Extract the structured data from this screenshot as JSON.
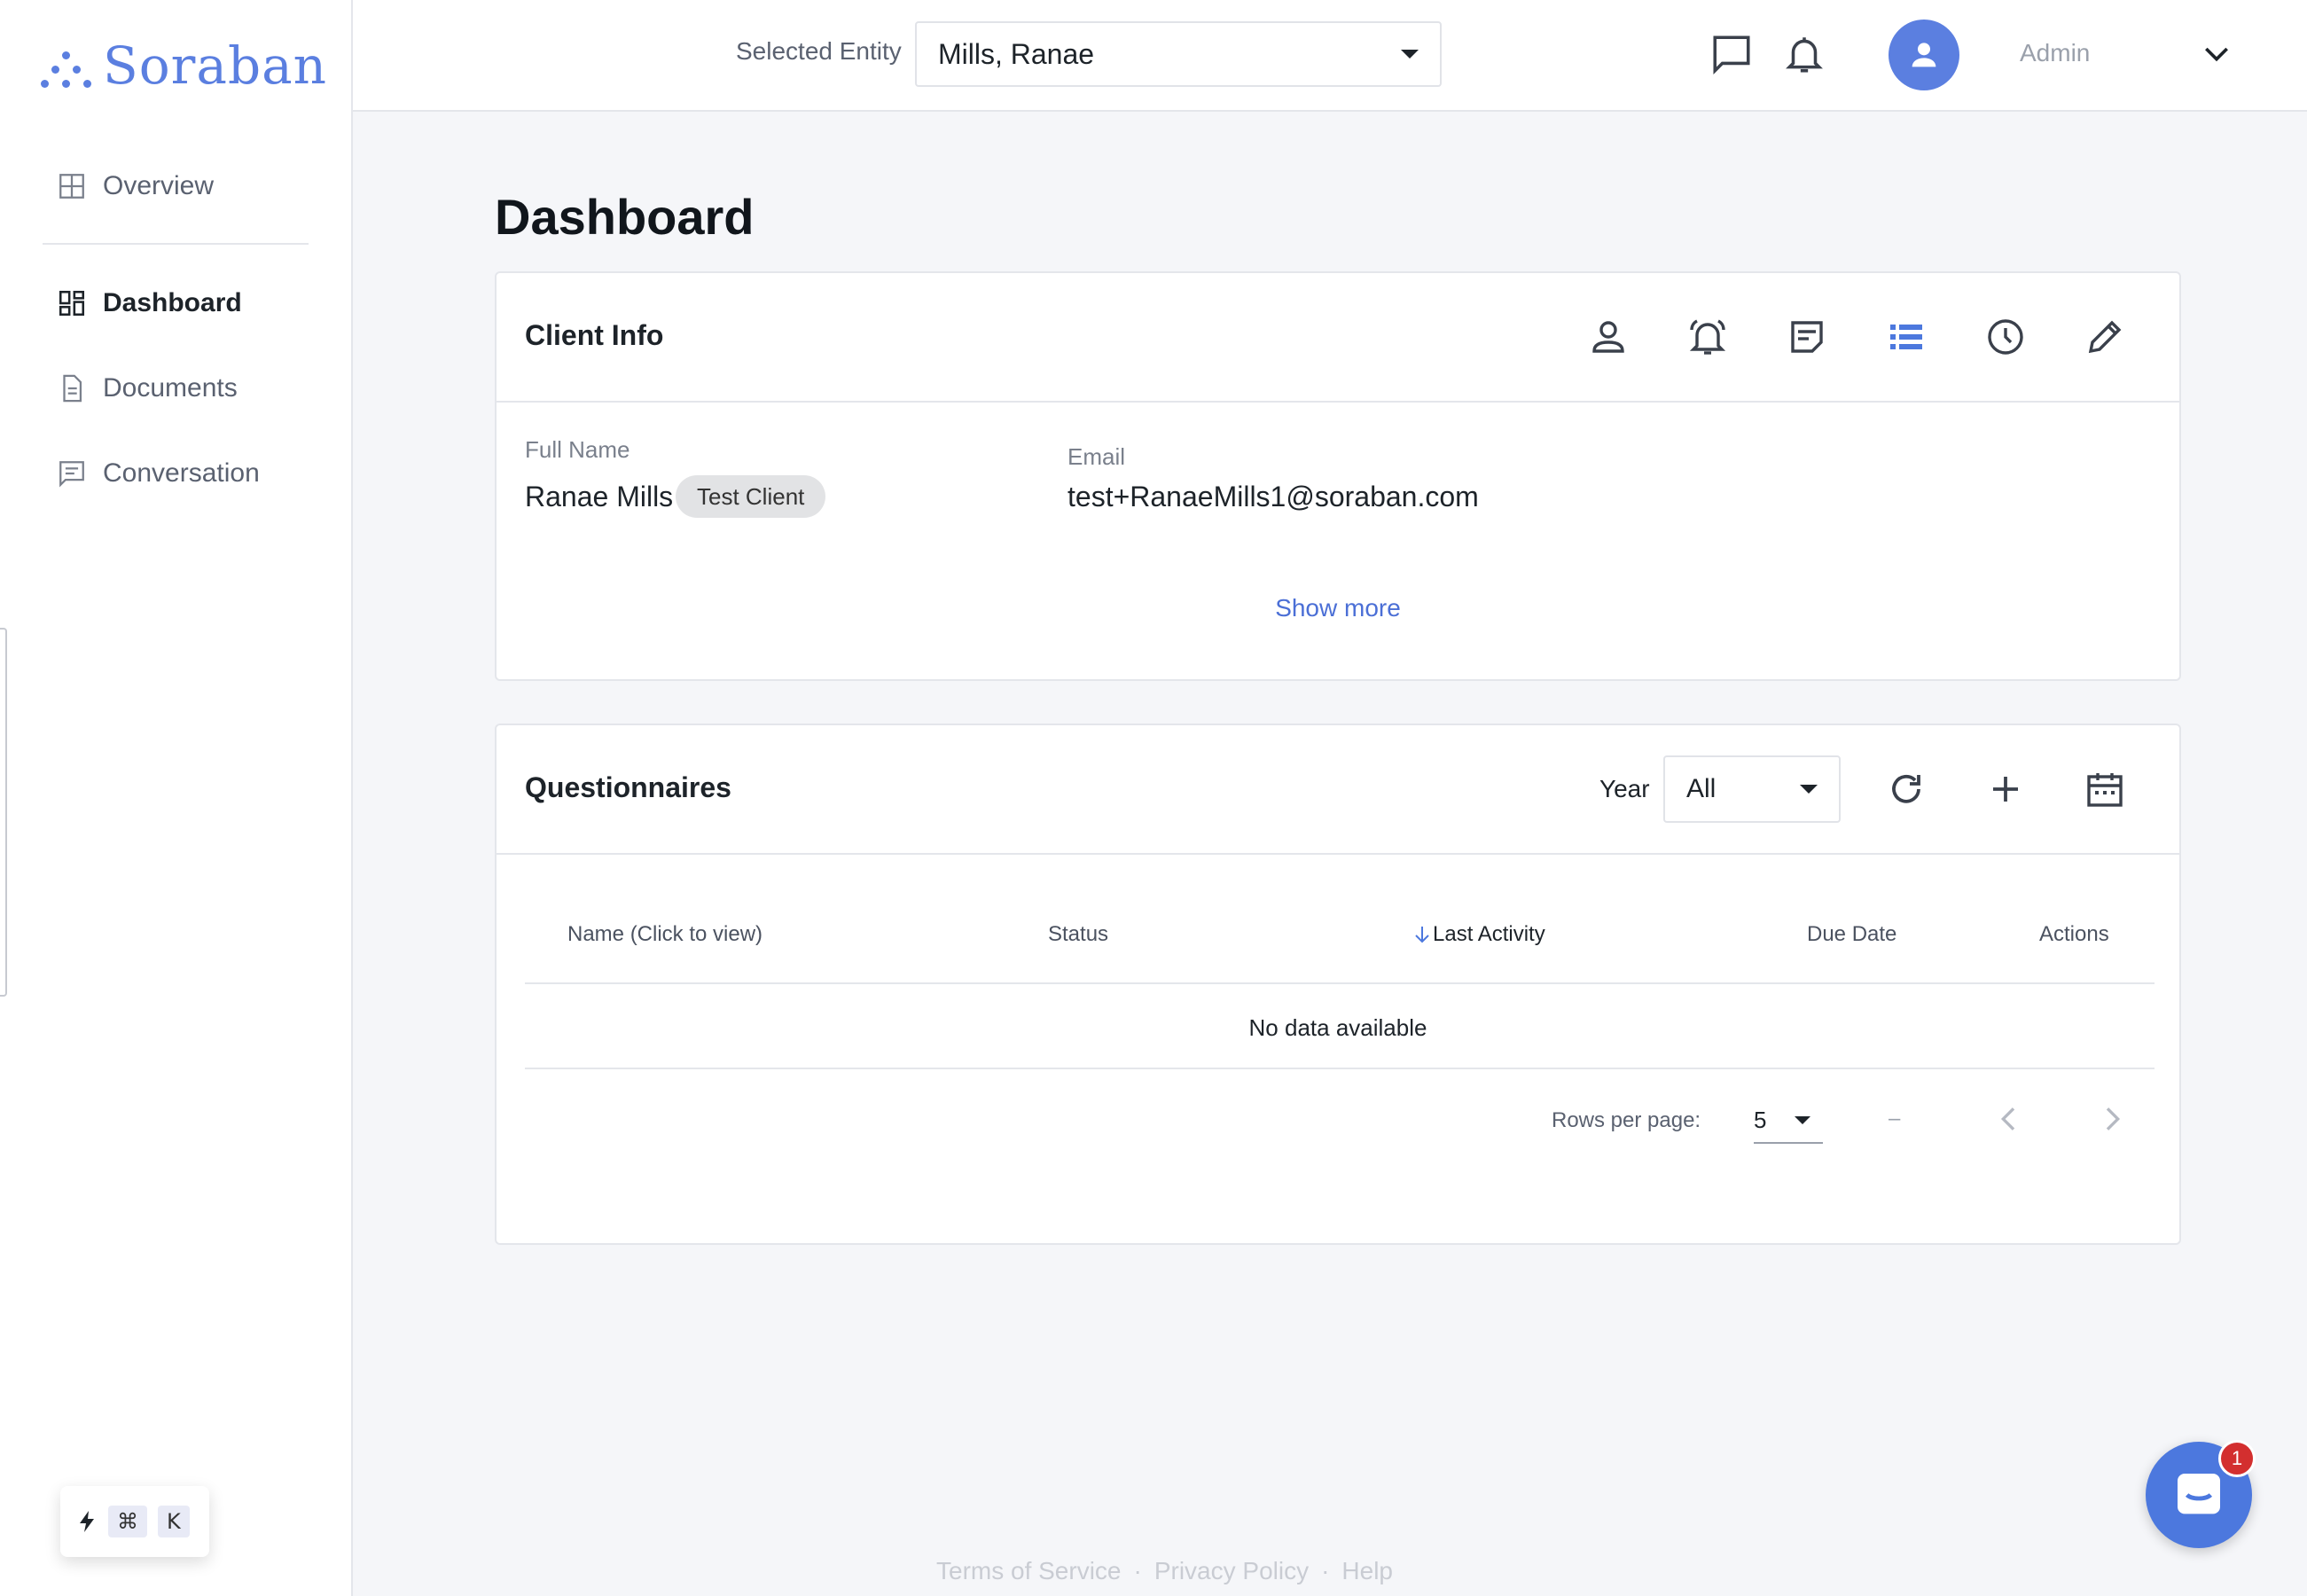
{
  "brand": {
    "name": "Soraban",
    "accent": "#5b7fe0"
  },
  "sidebar": {
    "items": [
      {
        "label": "Overview",
        "icon": "grid-icon"
      },
      {
        "label": "Dashboard",
        "icon": "dashboard-icon",
        "active": true
      },
      {
        "label": "Documents",
        "icon": "document-icon"
      },
      {
        "label": "Conversation",
        "icon": "chat-icon"
      }
    ],
    "shortcut": {
      "symbol": "⌘",
      "key": "K"
    }
  },
  "topbar": {
    "entity_label": "Selected Entity",
    "entity_value": "Mills, Ranae",
    "user_role": "Admin"
  },
  "page": {
    "title": "Dashboard"
  },
  "client_info": {
    "title": "Client Info",
    "full_name_label": "Full Name",
    "full_name": "Ranae Mills",
    "tag": "Test Client",
    "email_label": "Email",
    "email": "test+RanaeMills1@soraban.com",
    "show_more": "Show more"
  },
  "questionnaires": {
    "title": "Questionnaires",
    "year_label": "Year",
    "year_value": "All",
    "columns": [
      "Name (Click to view)",
      "Status",
      "Last Activity",
      "Due Date",
      "Actions"
    ],
    "empty_text": "No data available",
    "rows_per_page_label": "Rows per page:",
    "rows_per_page_value": "5",
    "range_text": "–"
  },
  "footer": {
    "links": [
      "Terms of Service",
      "Privacy Policy",
      "Help"
    ],
    "separator": "·"
  },
  "chat": {
    "badge": "1"
  }
}
